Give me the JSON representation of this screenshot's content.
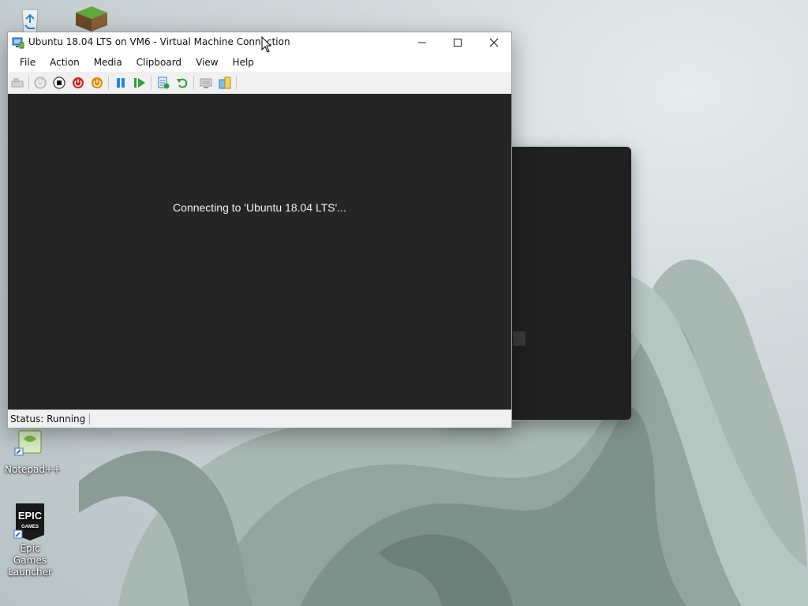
{
  "desktop": {
    "icons": [
      {
        "name": "recycle-bin",
        "label": ""
      },
      {
        "name": "minecraft",
        "label": ""
      },
      {
        "name": "notepadpp",
        "label": "Notepad++"
      },
      {
        "name": "epic-games",
        "label": "Epic Games Launcher",
        "badge_text": "EPIC GAMES"
      }
    ]
  },
  "vm_window": {
    "title": "Ubuntu 18.04 LTS on VM6 - Virtual Machine Connection",
    "controls": {
      "minimize": "minimize-icon",
      "maximize": "maximize-icon",
      "close": "close-icon"
    },
    "menu": [
      "File",
      "Action",
      "Media",
      "Clipboard",
      "View",
      "Help"
    ],
    "toolbar_icons": [
      "ctrl-alt-del-icon",
      "start-icon",
      "turn-off-icon",
      "shutdown-icon",
      "save-state-icon",
      "pause-icon",
      "reset-icon",
      "checkpoint-icon",
      "revert-icon",
      "enhanced-session-icon",
      "share-icon"
    ],
    "screen_message": "Connecting to 'Ubuntu 18.04 LTS'...",
    "status": "Status: Running"
  },
  "colors": {
    "screen_bg": "#252525",
    "shutdown_red": "#c62828",
    "save_orange": "#e08a00",
    "pause_blue": "#1e88e5",
    "reset_green": "#2e9e3a"
  }
}
